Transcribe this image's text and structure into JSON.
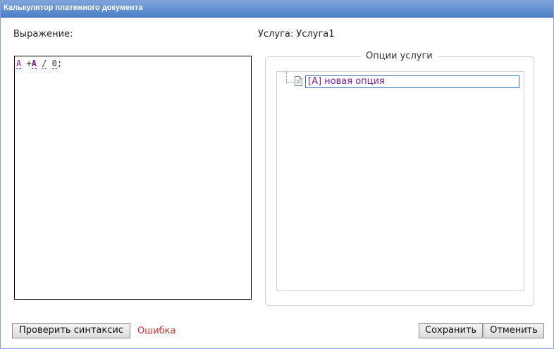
{
  "window": {
    "title": "Калькулятор платежного документа"
  },
  "expression": {
    "label": "Выражение:",
    "tokens": {
      "var1": "A",
      "op1": "+",
      "var2": "A",
      "op2": "/",
      "num": "0",
      "end": ";"
    }
  },
  "service": {
    "label": "Услуга:",
    "value": "Услуга1"
  },
  "options": {
    "legend": "Опции услуги",
    "items": [
      {
        "label": "[A] новая опция",
        "icon": "document-icon"
      }
    ]
  },
  "footer": {
    "check_syntax_label": "Проверить синтаксис",
    "status_text": "Ошибка",
    "save_label": "Сохранить",
    "cancel_label": "Отменить"
  },
  "colors": {
    "title_bar": "#4d7fc6",
    "variable": "#7b1fa2",
    "error": "#d32f2f"
  }
}
